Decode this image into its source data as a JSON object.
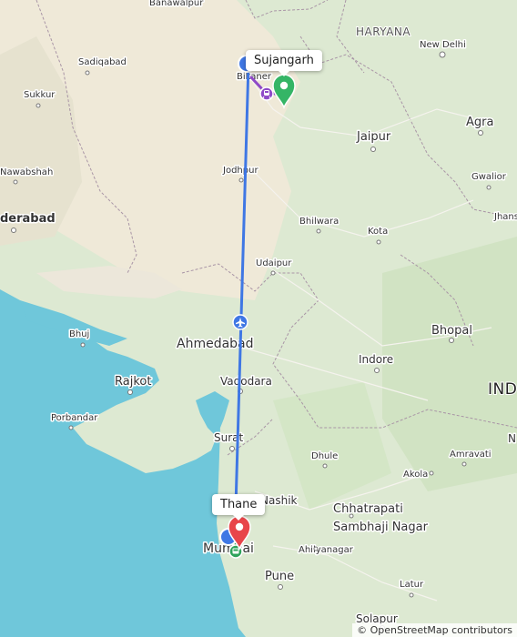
{
  "map": {
    "region_labels": [
      {
        "text": "HARYANA"
      },
      {
        "text": "INDI"
      }
    ],
    "cities": [
      {
        "text": "Banawalpur"
      },
      {
        "text": "Sadiqabad"
      },
      {
        "text": "Sukkur"
      },
      {
        "text": "Nawabshah"
      },
      {
        "text": "derabad"
      },
      {
        "text": "Bikaner"
      },
      {
        "text": "Jodhpur"
      },
      {
        "text": "Jaipur"
      },
      {
        "text": "New Delhi"
      },
      {
        "text": "Agra"
      },
      {
        "text": "Gwalior"
      },
      {
        "text": "Jhans"
      },
      {
        "text": "Bhilwara"
      },
      {
        "text": "Kota"
      },
      {
        "text": "Udaipur"
      },
      {
        "text": "Bhuj"
      },
      {
        "text": "Ahmedabad"
      },
      {
        "text": "Rajkot"
      },
      {
        "text": "Vadodara"
      },
      {
        "text": "Porbandar"
      },
      {
        "text": "Surat"
      },
      {
        "text": "Bhopal"
      },
      {
        "text": "Indore"
      },
      {
        "text": "Dhule"
      },
      {
        "text": "Amravati"
      },
      {
        "text": "Akola"
      },
      {
        "text": "Nashik"
      },
      {
        "text": "Chhatrapati"
      },
      {
        "text": "Sambhaji Nagar"
      },
      {
        "text": "Ahilyanagar"
      },
      {
        "text": "Mumbai"
      },
      {
        "text": "Pune"
      },
      {
        "text": "Latur"
      },
      {
        "text": "Solapur"
      },
      {
        "text": "N"
      }
    ],
    "route": {
      "mode": "flight",
      "color": "#3f77e4",
      "origin_marker_color": "#e8454a",
      "destination_marker_color": "#35b566"
    },
    "callouts": {
      "destination": "Sujangarh",
      "origin": "Thane"
    },
    "icons": {
      "flight": "airplane-icon",
      "train": "train-icon",
      "bus": "bus-icon"
    },
    "attribution": "© OpenStreetMap contributors"
  }
}
